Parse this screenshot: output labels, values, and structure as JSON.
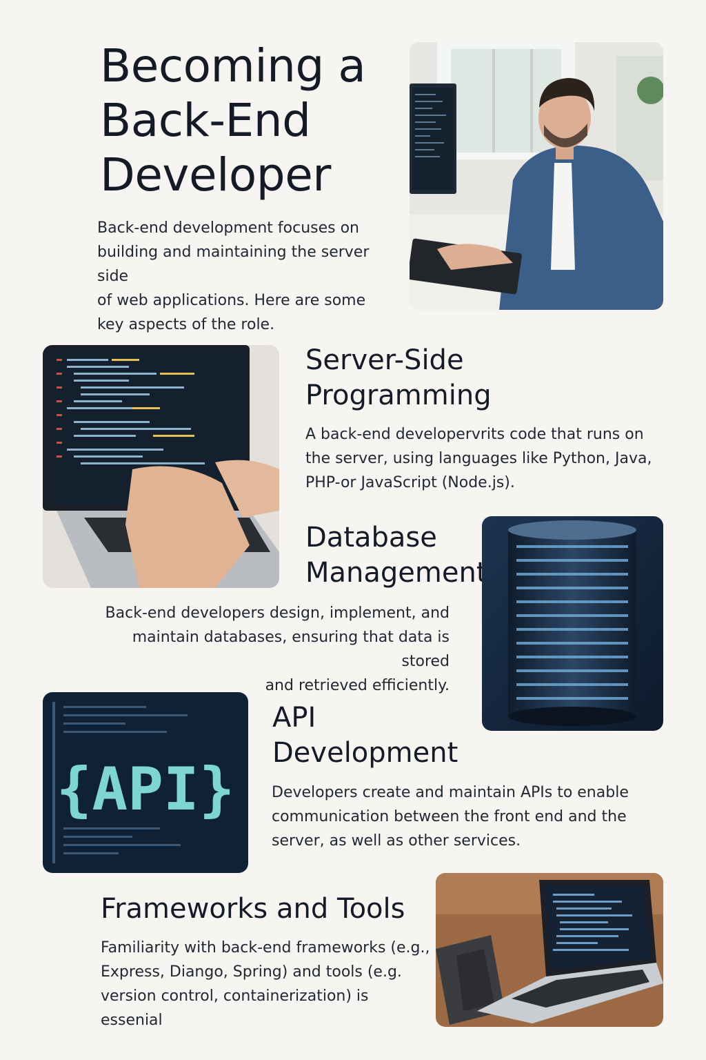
{
  "title": {
    "lines": [
      "Becoming a",
      "Back-End",
      "Developer"
    ]
  },
  "intro": {
    "lines": [
      "Back-end development focuses on",
      "building and maintaining the server side",
      "of web applications. Here are some",
      "key aspects of the role."
    ]
  },
  "sections": [
    {
      "heading_lines": [
        "Server-Side",
        "Programming"
      ],
      "body_lines": [
        "A back-end developervrits code that runs on",
        "the server, using languages like Python, Java,",
        "PHP-or JavaScript (Node.js)."
      ]
    },
    {
      "heading_lines": [
        "Database",
        "Management"
      ],
      "body_lines": [
        "Back-end developers design, implement, and",
        "maintain databases, ensuring that data is stored",
        "and retrieved efficiently."
      ]
    },
    {
      "heading_lines": [
        "API",
        "Development"
      ],
      "body_lines": [
        "Developers create and maintain APIs to enable",
        "communication between the front end and the",
        "server, as well as other services."
      ]
    },
    {
      "heading_lines": [
        "Frameworks and Tools"
      ],
      "body_lines": [
        "Familiarity with back-end frameworks (e.g.,",
        "Express, Diango, Spring) and tools (e.g.",
        "version control, containerization) is essenial"
      ]
    }
  ],
  "images": {
    "api_logo_text": "{API}"
  },
  "colors": {
    "background": "#f7f5f1",
    "text": "#141b26",
    "code_bg": "#0f2235",
    "code_accent": "#7fd6d0"
  }
}
